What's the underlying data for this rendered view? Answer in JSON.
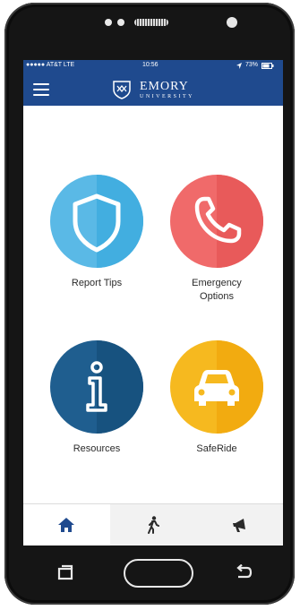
{
  "status": {
    "carrier": "●●●●● AT&T  LTE",
    "time": "10:56",
    "battery": "73%"
  },
  "header": {
    "brand_line1": "EMORY",
    "brand_line2": "UNIVERSITY"
  },
  "tiles": [
    {
      "label_lines": [
        "Report Tips"
      ],
      "icon": "shield-icon",
      "color": "#5ab9e6"
    },
    {
      "label_lines": [
        "Emergency",
        "Options"
      ],
      "icon": "phone-icon",
      "color": "#f06a6a"
    },
    {
      "label_lines": [
        "Resources"
      ],
      "icon": "info-icon",
      "color": "#1f5e8f"
    },
    {
      "label_lines": [
        "SafeRide"
      ],
      "icon": "car-icon",
      "color": "#f6b91f"
    }
  ],
  "tabs": [
    {
      "icon": "home-icon",
      "active": true
    },
    {
      "icon": "walking-person-icon",
      "active": false
    },
    {
      "icon": "megaphone-icon",
      "active": false
    }
  ],
  "colors": {
    "brand_blue": "#1f4a8e"
  }
}
